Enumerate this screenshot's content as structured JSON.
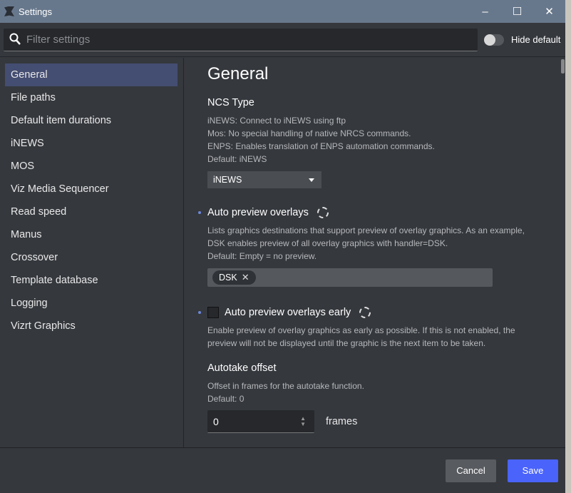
{
  "window": {
    "title": "Settings",
    "minimize": "–",
    "maximize": "☐",
    "close": "✕"
  },
  "search": {
    "placeholder": "Filter settings",
    "value": ""
  },
  "hide_default": {
    "label": "Hide default",
    "on": false
  },
  "sidebar": {
    "items": [
      {
        "label": "General",
        "active": true
      },
      {
        "label": "File paths"
      },
      {
        "label": "Default item durations"
      },
      {
        "label": "iNEWS"
      },
      {
        "label": "MOS"
      },
      {
        "label": "Viz Media Sequencer"
      },
      {
        "label": "Read speed"
      },
      {
        "label": "Manus"
      },
      {
        "label": "Crossover"
      },
      {
        "label": "Template database"
      },
      {
        "label": "Logging"
      },
      {
        "label": "Vizrt Graphics"
      }
    ]
  },
  "main": {
    "title": "General",
    "ncs": {
      "title": "NCS Type",
      "lines": [
        "iNEWS: Connect to iNEWS using ftp",
        "Mos: No special handling of native NRCS commands.",
        "ENPS: Enables translation of ENPS automation commands.",
        "Default: iNEWS"
      ],
      "value": "iNEWS"
    },
    "apo": {
      "title": "Auto preview overlays",
      "lines": [
        "Lists graphics destinations that support preview of overlay graphics. As an example,",
        "DSK enables preview of all overlay graphics with handler=DSK.",
        "Default: Empty = no preview."
      ],
      "tags": [
        "DSK"
      ]
    },
    "apoe": {
      "title": "Auto preview overlays early",
      "checked": false,
      "lines": [
        "Enable preview of overlay graphics as early as possible. If this is not enabled, the",
        "preview will not be displayed until the graphic is the next item to be taken."
      ]
    },
    "ato": {
      "title": "Autotake offset",
      "lines": [
        "Offset in frames for the autotake function.",
        "Default: 0"
      ],
      "value": "0",
      "unit": "frames"
    }
  },
  "footer": {
    "cancel": "Cancel",
    "save": "Save"
  },
  "colors": {
    "accent": "#4a63fb",
    "titlebar": "#68788c",
    "selected": "#444e72"
  }
}
